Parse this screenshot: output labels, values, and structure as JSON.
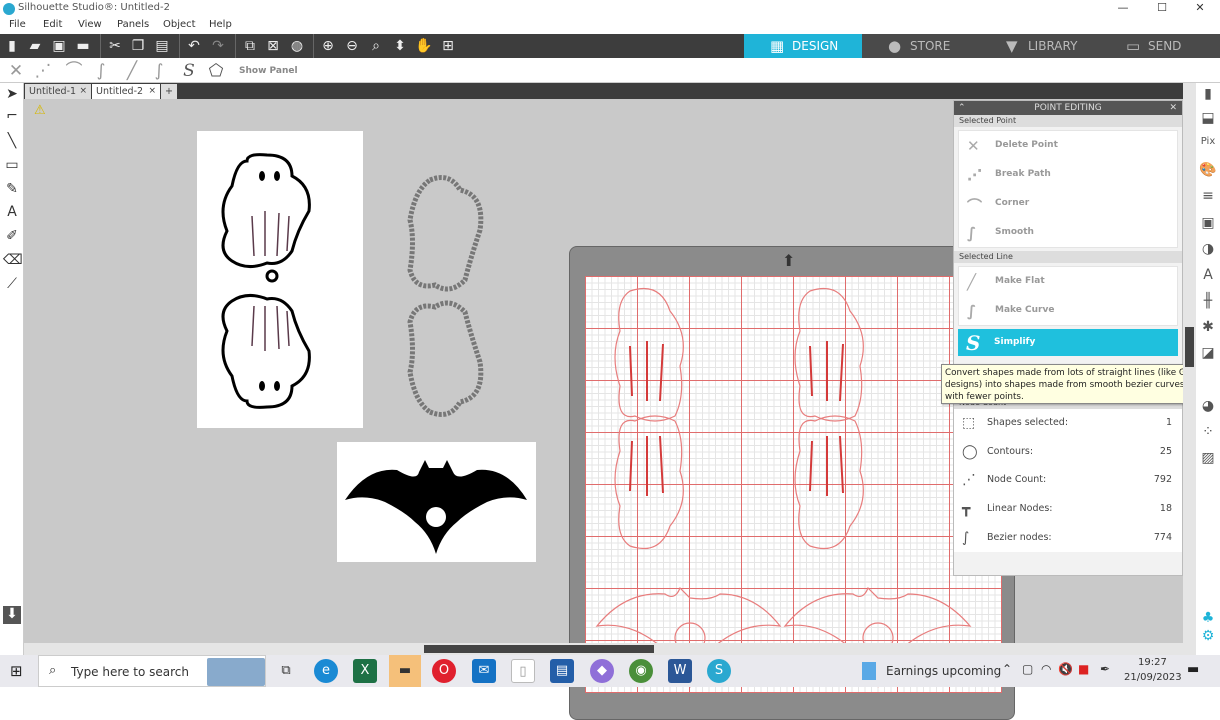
{
  "window": {
    "title": "Silhouette Studio®: Untitled-2",
    "minimize": "—",
    "maximize": "☐",
    "close": "✕"
  },
  "menu": [
    "File",
    "Edit",
    "View",
    "Panels",
    "Object",
    "Help"
  ],
  "nav_tabs": [
    {
      "label": "DESIGN",
      "icon": "grid-icon",
      "active": true
    },
    {
      "label": "STORE",
      "icon": "silhouette-s-icon"
    },
    {
      "label": "LIBRARY",
      "icon": "download-folder-icon"
    },
    {
      "label": "SEND",
      "icon": "cutter-icon"
    }
  ],
  "subbar": {
    "show_panel": "Show Panel"
  },
  "doc_tabs": [
    {
      "label": "Untitled-1",
      "active": false
    },
    {
      "label": "Untitled-2",
      "active": true
    }
  ],
  "doc_tab_add": "+",
  "point_editing": {
    "title": "POINT EDITING",
    "selected_point": "Selected Point",
    "point_actions": [
      "Delete Point",
      "Break Path",
      "Corner",
      "Smooth"
    ],
    "selected_line": "Selected Line",
    "line_actions": [
      "Make Flat",
      "Make Curve"
    ],
    "simplify": "Simplify",
    "node_count_title": "Node Count",
    "node_count": [
      {
        "label": "Shapes selected:",
        "value": "1"
      },
      {
        "label": "Contours:",
        "value": "25"
      },
      {
        "label": "Node Count:",
        "value": "792"
      },
      {
        "label": "Linear Nodes:",
        "value": "18"
      },
      {
        "label": "Bezier nodes:",
        "value": "774"
      }
    ]
  },
  "tooltip": "Convert shapes made from lots of straight lines (like GSD designs) into shapes made from smooth bezier curves, and with fewer points.",
  "accent": "#1fb4d8",
  "taskbar": {
    "search_placeholder": "Type here to search",
    "news": "Earnings upcoming",
    "time": "19:27",
    "date": "21/09/2023"
  }
}
